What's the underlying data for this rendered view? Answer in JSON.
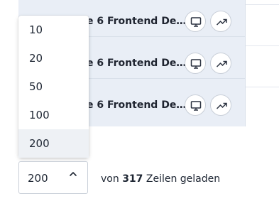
{
  "table": {
    "rows": [
      {
        "name": "e 6 Frontend De…"
      },
      {
        "name": "e 6 Frontend De…"
      },
      {
        "name": "e 6 Frontend De…"
      }
    ],
    "row_icons": [
      "monitor-icon",
      "trending-up-icon"
    ]
  },
  "page_size": {
    "options": [
      "10",
      "20",
      "50",
      "100",
      "200"
    ],
    "selected": "200"
  },
  "status": {
    "prefix": "von",
    "count": "317",
    "suffix": "Zeilen geladen"
  },
  "colors": {
    "row_background": "#e9eef6",
    "text": "#1e2633",
    "border": "#c9cfd8",
    "selected_option": "#eef1f5"
  }
}
